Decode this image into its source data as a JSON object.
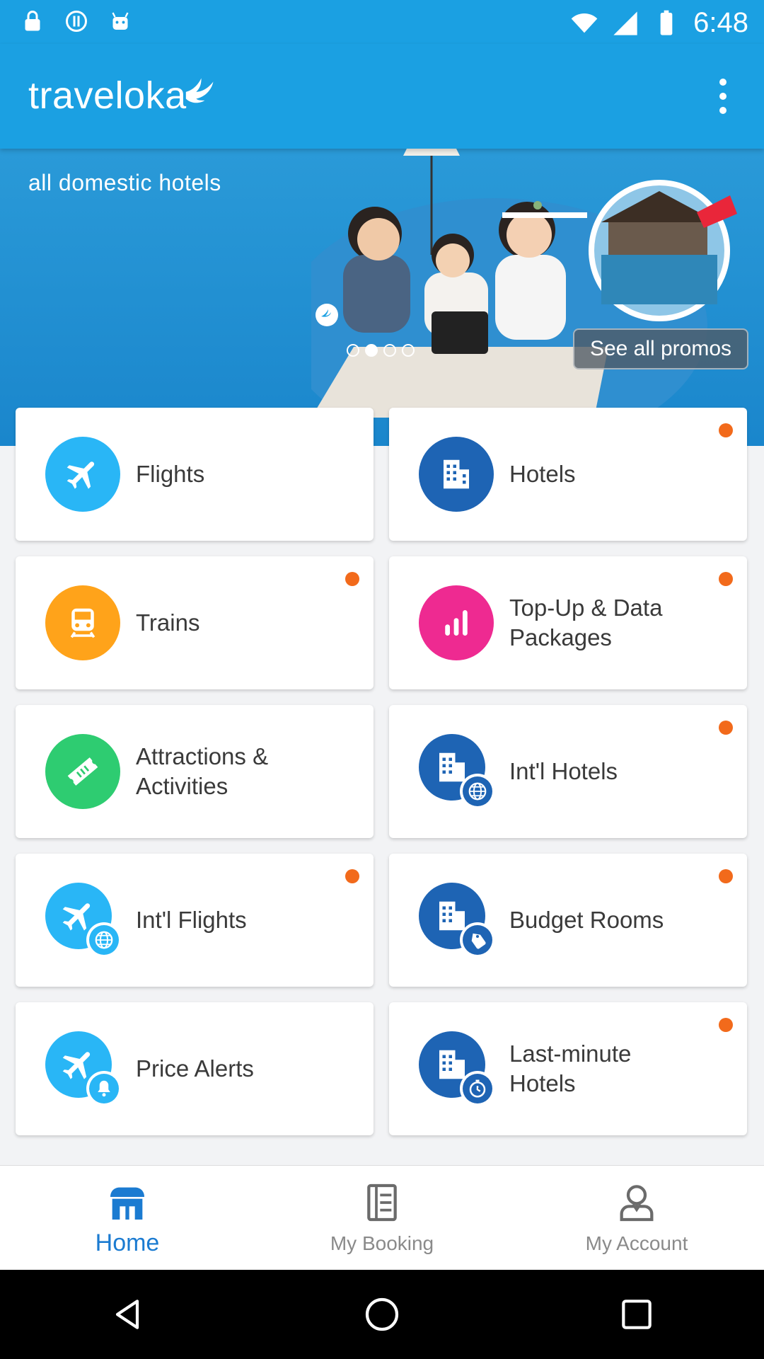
{
  "status_bar": {
    "time": "6:48",
    "icons": [
      "lock-icon",
      "alert-circle-icon",
      "android-icon",
      "wifi-icon",
      "signal-icon",
      "battery-icon"
    ]
  },
  "app_bar": {
    "logo_text": "traveloka",
    "menu_icon": "more-vert-icon",
    "color": "#1ba0e2"
  },
  "banner": {
    "headline": "all domestic hotels",
    "see_all_label": "See all promos",
    "dots": 4,
    "active_dot": 1
  },
  "products": [
    {
      "label": "Flights",
      "icon": "plane-icon",
      "color": "#29b6f6",
      "badge": null,
      "new_dot": false
    },
    {
      "label": "Hotels",
      "icon": "building-icon",
      "color": "#1e64b4",
      "badge": null,
      "new_dot": true
    },
    {
      "label": "Trains",
      "icon": "train-icon",
      "color": "#ffa31a",
      "badge": null,
      "new_dot": true
    },
    {
      "label": "Top-Up & Data Packages",
      "icon": "bar-chart-icon",
      "color": "#ee2a91",
      "badge": null,
      "new_dot": true
    },
    {
      "label": "Attractions & Activities",
      "icon": "ticket-icon",
      "color": "#2ecc71",
      "badge": null,
      "new_dot": false
    },
    {
      "label": "Int'l Hotels",
      "icon": "building-icon",
      "color": "#1e64b4",
      "badge": "globe-icon",
      "new_dot": true
    },
    {
      "label": "Int'l Flights",
      "icon": "plane-icon",
      "color": "#29b6f6",
      "badge": "globe-icon",
      "new_dot": true
    },
    {
      "label": "Budget Rooms",
      "icon": "building-icon",
      "color": "#1e64b4",
      "badge": "tag-icon",
      "new_dot": true
    },
    {
      "label": "Price Alerts",
      "icon": "plane-icon",
      "color": "#29b6f6",
      "badge": "bell-icon",
      "new_dot": false
    },
    {
      "label": "Last-minute Hotels",
      "icon": "building-icon",
      "color": "#1e64b4",
      "badge": "clock-icon",
      "new_dot": true
    }
  ],
  "bottom_nav": [
    {
      "label": "Home",
      "icon": "home-icon",
      "active": true
    },
    {
      "label": "My Booking",
      "icon": "booking-icon",
      "active": false
    },
    {
      "label": "My Account",
      "icon": "account-icon",
      "active": false
    }
  ],
  "accent_color": "#1b7bd1",
  "new_dot_color": "#f26a1b"
}
